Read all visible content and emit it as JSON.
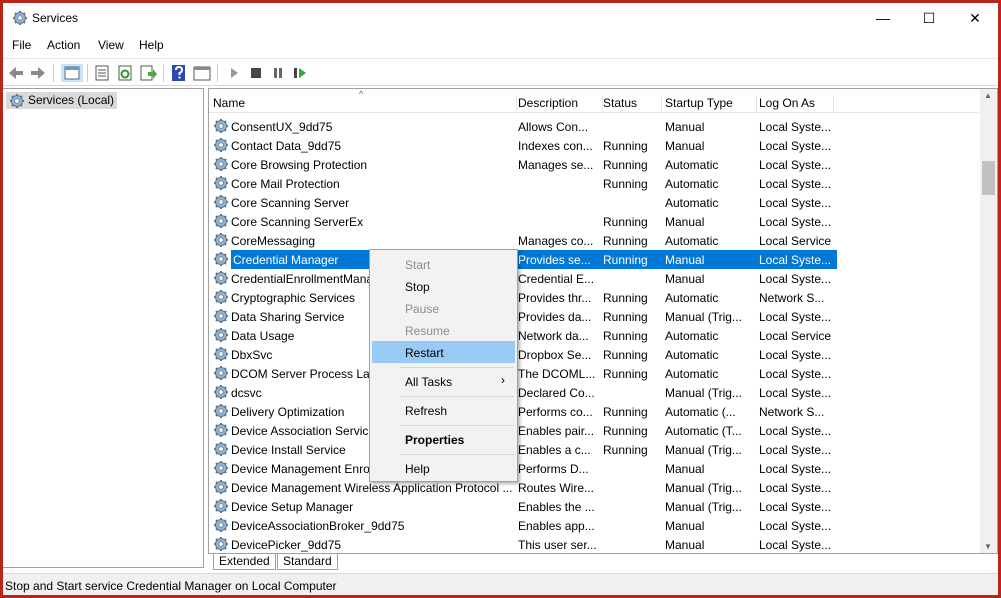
{
  "window": {
    "title": "Services",
    "minimize": "—",
    "maximize": "☐",
    "close": "✕"
  },
  "menu": [
    "File",
    "Action",
    "View",
    "Help"
  ],
  "toolbar": {
    "icons": [
      "back-icon",
      "forward-icon",
      "show-hide-tree-icon",
      "properties-icon",
      "refresh-icon",
      "export-list-icon",
      "help-icon",
      "show-action-pane-icon",
      "start-service-icon",
      "stop-service-icon",
      "pause-service-icon",
      "restart-service-icon"
    ]
  },
  "tree": {
    "root": "Services (Local)"
  },
  "columns": [
    "Name",
    "Description",
    "Status",
    "Startup Type",
    "Log On As"
  ],
  "rows": [
    [
      "ConsentUX_9dd75",
      "Allows Con...",
      "",
      "Manual",
      "Local Syste..."
    ],
    [
      "Contact Data_9dd75",
      "Indexes con...",
      "Running",
      "Manual",
      "Local Syste..."
    ],
    [
      "Core Browsing Protection",
      "Manages se...",
      "Running",
      "Automatic",
      "Local Syste..."
    ],
    [
      "Core Mail Protection",
      "",
      "Running",
      "Automatic",
      "Local Syste..."
    ],
    [
      "Core Scanning Server",
      "",
      "",
      "Automatic",
      "Local Syste..."
    ],
    [
      "Core Scanning ServerEx",
      "",
      "Running",
      "Manual",
      "Local Syste..."
    ],
    [
      "CoreMessaging",
      "Manages co...",
      "Running",
      "Automatic",
      "Local Service"
    ],
    [
      "Credential Manager",
      "Provides se...",
      "Running",
      "Manual",
      "Local Syste..."
    ],
    [
      "CredentialEnrollmentManagerUserSvc_9dd75",
      "Credential E...",
      "",
      "Manual",
      "Local Syste..."
    ],
    [
      "Cryptographic Services",
      "Provides thr...",
      "Running",
      "Automatic",
      "Network S..."
    ],
    [
      "Data Sharing Service",
      "Provides da...",
      "Running",
      "Manual (Trig...",
      "Local Syste..."
    ],
    [
      "Data Usage",
      "Network da...",
      "Running",
      "Automatic",
      "Local Service"
    ],
    [
      "DbxSvc",
      "Dropbox Se...",
      "Running",
      "Automatic",
      "Local Syste..."
    ],
    [
      "DCOM Server Process Launcher",
      "The DCOML...",
      "Running",
      "Automatic",
      "Local Syste..."
    ],
    [
      "dcsvc",
      "Declared Co...",
      "",
      "Manual (Trig...",
      "Local Syste..."
    ],
    [
      "Delivery Optimization",
      "Performs co...",
      "Running",
      "Automatic (...",
      "Network S..."
    ],
    [
      "Device Association Service",
      "Enables pair...",
      "Running",
      "Automatic (T...",
      "Local Syste..."
    ],
    [
      "Device Install Service",
      "Enables a c...",
      "Running",
      "Manual (Trig...",
      "Local Syste..."
    ],
    [
      "Device Management Enrollment Service",
      "Performs D...",
      "",
      "Manual",
      "Local Syste..."
    ],
    [
      "Device Management Wireless Application Protocol ...",
      "Routes Wire...",
      "",
      "Manual (Trig...",
      "Local Syste..."
    ],
    [
      "Device Setup Manager",
      "Enables the ...",
      "",
      "Manual (Trig...",
      "Local Syste..."
    ],
    [
      "DeviceAssociationBroker_9dd75",
      "Enables app...",
      "",
      "Manual",
      "Local Syste..."
    ],
    [
      "DevicePicker_9dd75",
      "This user ser...",
      "",
      "Manual",
      "Local Syste..."
    ]
  ],
  "selected_row": "Credential Manager",
  "context_menu": {
    "start": "Start",
    "stop": "Stop",
    "pause": "Pause",
    "resume": "Resume",
    "restart": "Restart",
    "all_tasks": "All Tasks",
    "submenu_arrow": "›",
    "refresh": "Refresh",
    "properties": "Properties",
    "help": "Help"
  },
  "tabs": [
    "Extended",
    "Standard"
  ],
  "status_bar": "Stop and Start service Credential Manager on Local Computer",
  "colors": {
    "selection": "#0078d7",
    "menu_highlight": "#99c9f5",
    "frame": "#b8261a"
  }
}
